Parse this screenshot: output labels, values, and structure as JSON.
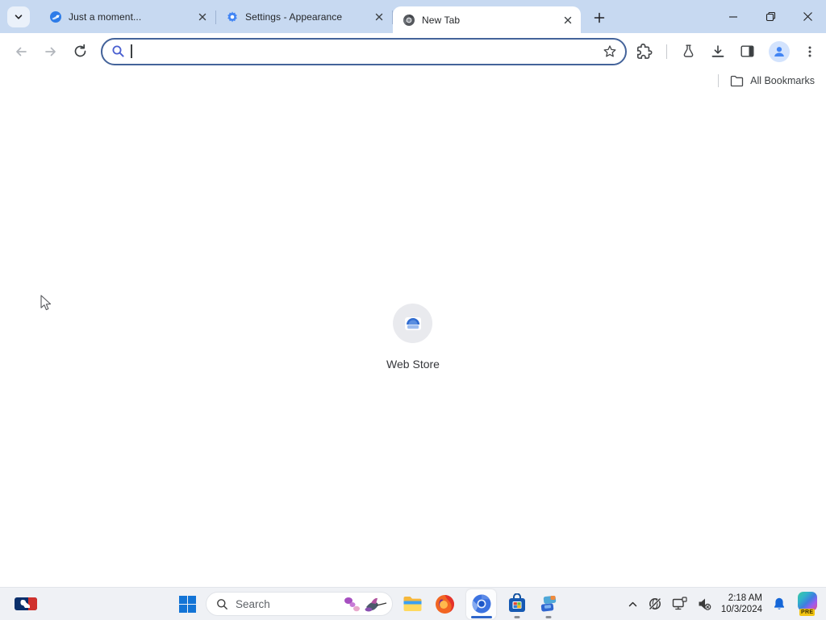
{
  "browser": {
    "tabs": [
      {
        "title": "Just a moment...",
        "favicon": "comet-icon",
        "active": false
      },
      {
        "title": "Settings - Appearance",
        "favicon": "gear-icon",
        "active": false
      },
      {
        "title": "New Tab",
        "favicon": "chromium-gray-icon",
        "active": true
      }
    ],
    "omnibox": {
      "value": "",
      "focused": true
    },
    "bookmarks": {
      "all_bookmarks": "All Bookmarks"
    },
    "colors": {
      "tabstrip_bg": "#c7d9f1",
      "toolbar_bg": "#ffffff",
      "omnibox_focus_border": "#44639a",
      "profile_accent": "#4285f4"
    }
  },
  "page": {
    "webstore_label": "Web Store"
  },
  "taskbar": {
    "search_placeholder": "Search",
    "clock": {
      "time": "2:18 AM",
      "date": "10/3/2024"
    },
    "pre_badge": "PRE",
    "colors": {
      "bg": "#eff1f5",
      "active_indicator": "#2e65c9"
    }
  }
}
